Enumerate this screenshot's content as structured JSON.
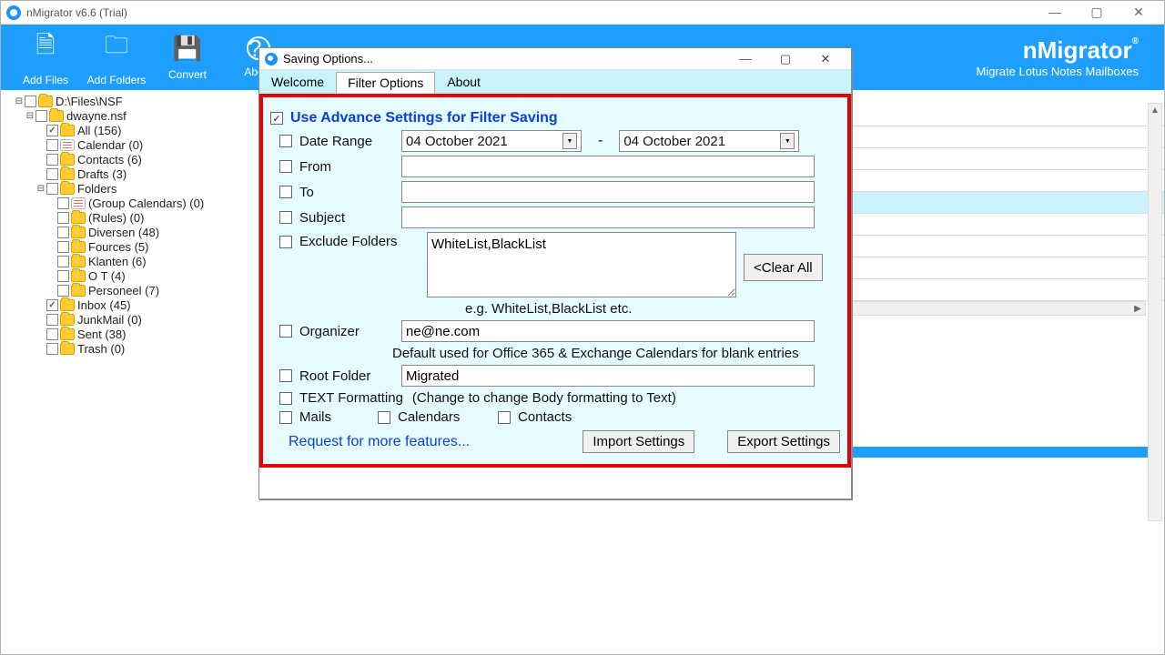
{
  "window": {
    "title": "nMigrator v6.6 (Trial)",
    "min": "—",
    "max": "▢",
    "close": "✕"
  },
  "toolbar": {
    "items": [
      {
        "icon": "🗎",
        "label": "Add Files"
      },
      {
        "icon": "🗀",
        "label": "Add Folders"
      },
      {
        "icon": "💾",
        "label": "Convert"
      },
      {
        "icon": "?",
        "label": "About"
      }
    ],
    "brand_title": "nMigrator",
    "brand_reg": "®",
    "brand_sub": "Migrate Lotus Notes Mailboxes"
  },
  "tree": [
    {
      "ind": 1,
      "exp": "⊟",
      "label": "D:\\Files\\NSF"
    },
    {
      "ind": 2,
      "exp": "⊟",
      "label": "dwayne.nsf"
    },
    {
      "ind": 3,
      "checked": true,
      "label": "All (156)"
    },
    {
      "ind": 3,
      "icon": "cal",
      "label": "Calendar (0)"
    },
    {
      "ind": 3,
      "label": "Contacts (6)"
    },
    {
      "ind": 3,
      "label": "Drafts (3)"
    },
    {
      "ind": 3,
      "exp": "⊟",
      "label": "Folders"
    },
    {
      "ind": 4,
      "icon": "cal",
      "label": "(Group Calendars) (0)"
    },
    {
      "ind": 4,
      "label": "(Rules) (0)"
    },
    {
      "ind": 4,
      "label": "Diversen (48)"
    },
    {
      "ind": 4,
      "label": "Fources (5)"
    },
    {
      "ind": 4,
      "label": "Klanten (6)"
    },
    {
      "ind": 4,
      "label": "O T (4)"
    },
    {
      "ind": 4,
      "label": "Personeel (7)"
    },
    {
      "ind": 3,
      "checked": true,
      "label": "Inbox (45)"
    },
    {
      "ind": 3,
      "label": "JunkMail (0)"
    },
    {
      "ind": 3,
      "label": "Sent (38)"
    },
    {
      "ind": 3,
      "label": "Trash (0)"
    }
  ],
  "dialog": {
    "title": "Saving Options...",
    "tabs": {
      "welcome": "Welcome",
      "filter": "Filter Options",
      "about": "About",
      "active": "filter"
    },
    "adv_title": "Use Advance Settings for Filter Saving",
    "labels": {
      "date_range": "Date Range",
      "from": "From",
      "to": "To",
      "subject": "Subject",
      "exclude": "Exclude Folders",
      "organizer": "Organizer",
      "root": "Root Folder",
      "textfmt": "TEXT Formatting",
      "textfmt_hint": "(Change to change Body formatting to Text)",
      "mails": "Mails",
      "calendars": "Calendars",
      "contacts": "Contacts",
      "req": "Request for more features...",
      "import": "Import Settings",
      "export": "Export Settings",
      "clear": "<Clear All",
      "exclude_hint": "e.g. WhiteList,BlackList etc.",
      "org_hint": "Default used for Office 365 & Exchange Calendars for blank entries"
    },
    "values": {
      "date_from": "04   October   2021",
      "date_to": "04   October   2021",
      "from": "",
      "to": "",
      "subject": "",
      "exclude": "WhiteList,BlackList",
      "organizer": "ne@ne.com",
      "root": "Migrated"
    }
  }
}
